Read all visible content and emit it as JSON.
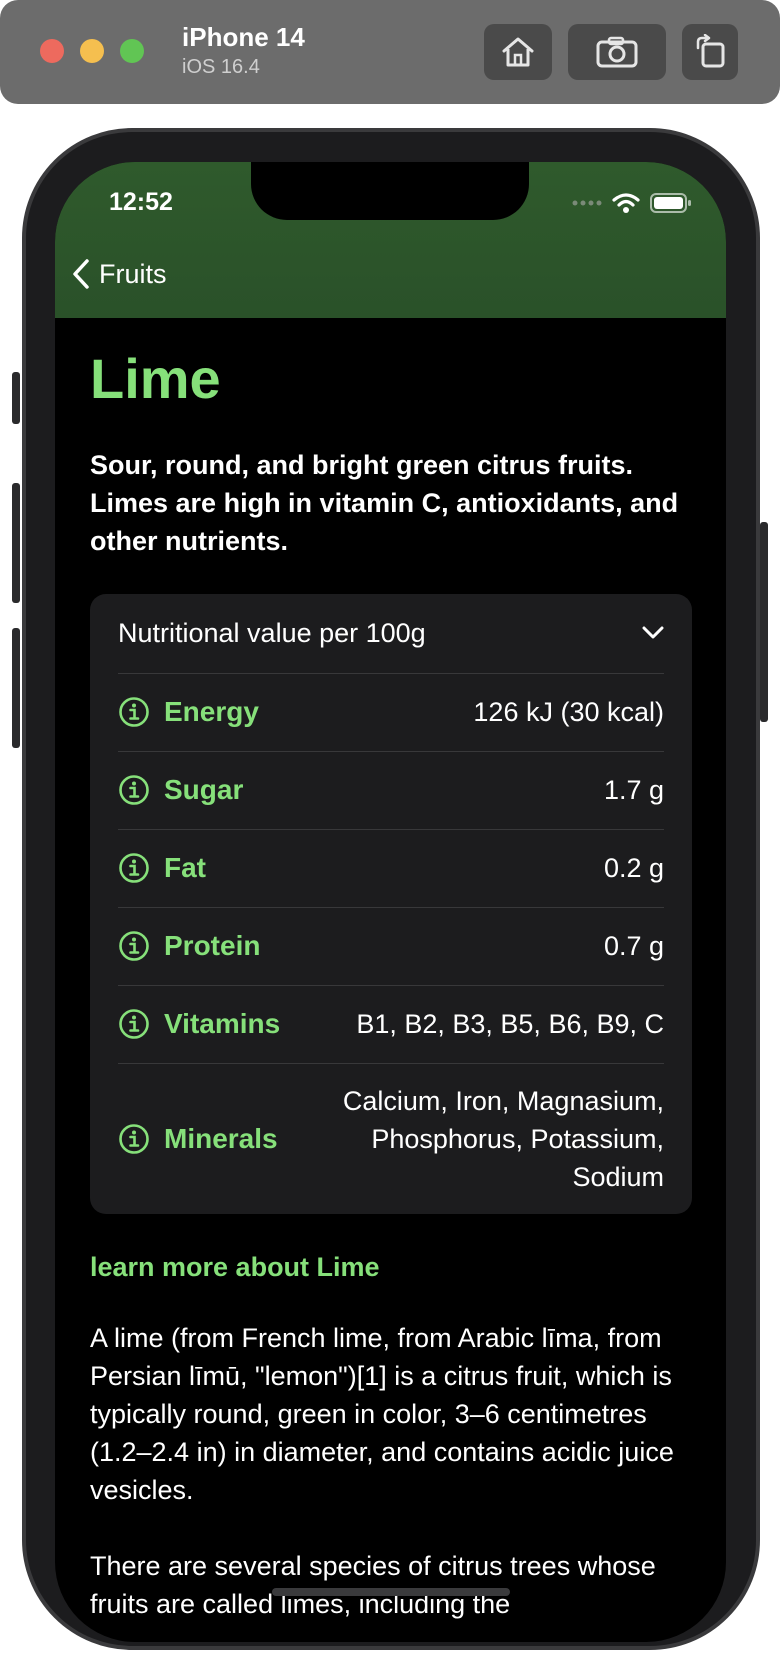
{
  "simulator": {
    "device_name": "iPhone 14",
    "os_version": "iOS 16.4",
    "toolbar_icons": [
      "home-icon",
      "screenshot-icon",
      "rotate-icon"
    ]
  },
  "status_bar": {
    "time": "12:52",
    "icons": [
      "signal-icon",
      "wifi-icon",
      "battery-icon"
    ]
  },
  "nav": {
    "back_label": "Fruits"
  },
  "fruit": {
    "title": "Lime",
    "summary": "Sour, round, and bright green citrus fruits. Limes are high in vitamin C, antioxidants, and other nutrients."
  },
  "nutrition": {
    "header": "Nutritional value per 100g",
    "rows": [
      {
        "label": "Energy",
        "value": "126 kJ (30 kcal)"
      },
      {
        "label": "Sugar",
        "value": "1.7 g"
      },
      {
        "label": "Fat",
        "value": "0.2 g"
      },
      {
        "label": "Protein",
        "value": "0.7 g"
      },
      {
        "label": "Vitamins",
        "value": "B1, B2, B3, B5, B6, B9, C"
      },
      {
        "label": "Minerals",
        "value": "Calcium, Iron, Magnasium, Phosphorus, Potassium, Sodium"
      }
    ]
  },
  "learn_more": "learn more about Lime",
  "description": [
    "A lime (from French lime, from Arabic līma, from Persian līmū, \"lemon\")[1] is a citrus fruit, which is typically round, green in color, 3–6 centimetres (1.2–2.4 in) in diameter, and contains acidic juice vesicles.",
    "There are several species of citrus trees whose fruits are called limes, including the"
  ],
  "colors": {
    "accent": "#86e07a",
    "header_bg": "#2f5a2c",
    "card_bg": "#1c1c1e",
    "screen_bg": "#000000"
  }
}
